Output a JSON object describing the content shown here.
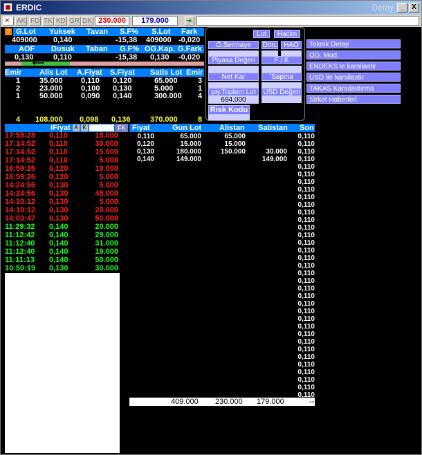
{
  "window": {
    "title": "ERDIC",
    "title_right": "Detay",
    "min": "_",
    "close": "X"
  },
  "toolbar": {
    "buttons": [
      "AK",
      "FD",
      "TK",
      "KD",
      "GR",
      "DK"
    ],
    "field1": "230.000",
    "field2": "179.000"
  },
  "top_table": {
    "row1_headers": [
      "G.Lot",
      "Yuksek",
      "Tavan",
      "S.F%",
      "S.Lot",
      "Fark"
    ],
    "row1_values": [
      "409000",
      "0,140",
      "",
      "-15,38",
      "409000",
      "-0,020"
    ],
    "row2_headers": [
      "AOF",
      "Dusuk",
      "Taban",
      "G.F%",
      "OG.Kap.",
      "G.Fark"
    ],
    "row2_values": [
      "0,130",
      "0,110",
      "",
      "-15,38",
      "0,130",
      "-0,020"
    ]
  },
  "depth": {
    "headers": [
      "Emir",
      "Alis Lot",
      "A.Fiyat",
      "S.Fiyat",
      "Satis Lot",
      "Emir"
    ],
    "rows": [
      [
        "1",
        "35.000",
        "0,110",
        "0,120",
        "65.000",
        "3"
      ],
      [
        "2",
        "23.000",
        "0,100",
        "0,130",
        "5.000",
        "1"
      ],
      [
        "1",
        "50.000",
        "0,090",
        "0,140",
        "300.000",
        "4"
      ]
    ],
    "totals": [
      "4",
      "108.000",
      "0,098",
      "0,136",
      "370.000",
      "8"
    ]
  },
  "panel": {
    "lot": "Lot",
    "hacim": "Hacim",
    "osermaye": "Ö.Sermaye",
    "don": "Dön.",
    "hao": "HAO",
    "piyasa": "Piyasa Değeri",
    "fk": "F / K",
    "netkar": "Net Kar",
    "sapma": "'Sapma",
    "piytoplam": "piy.Toplam Lot",
    "usd": "USD Değeri",
    "piyval": "694.000",
    "risk": "Risk Kodu"
  },
  "right_menu": [
    "Teknik Detay",
    "OD. Mod.",
    "ENDEKS le karsilastir",
    "USD ile karsilastir",
    "TAKAS Karsılastırma",
    "Sirket Haberleri"
  ],
  "trades": {
    "header": "IFiyat",
    "btn_a": "A",
    "btn_k": "K",
    "btn_fk": "FK",
    "rows": [
      [
        "17:58:28",
        "0,110",
        "15.000",
        "r"
      ],
      [
        "17:14:52",
        "0,110",
        "30.000",
        "r"
      ],
      [
        "17:14:52",
        "0,110",
        "15.000",
        "r"
      ],
      [
        "17:14:52",
        "0,110",
        "5.000",
        "r"
      ],
      [
        "16:59:26",
        "0,120",
        "10.000",
        "r"
      ],
      [
        "16:59:26",
        "0,120",
        "5.000",
        "r"
      ],
      [
        "14:24:56",
        "0,130",
        "5.000",
        "r"
      ],
      [
        "14:24:56",
        "0,130",
        "45.000",
        "r"
      ],
      [
        "14:10:12",
        "0,130",
        "5.000",
        "r"
      ],
      [
        "14:10:12",
        "0,130",
        "20.000",
        "r"
      ],
      [
        "14:03:47",
        "0,130",
        "50.000",
        "r"
      ],
      [
        "11:29:32",
        "0,140",
        "20.000",
        "g"
      ],
      [
        "11:12:42",
        "0,140",
        "29.000",
        "g"
      ],
      [
        "11:12:40",
        "0,140",
        "31.000",
        "g"
      ],
      [
        "11:12:40",
        "0,140",
        "19.000",
        "g"
      ],
      [
        "11:11:13",
        "0,140",
        "50.000",
        "g"
      ],
      [
        "10:50:19",
        "0,130",
        "30.000",
        "g"
      ]
    ]
  },
  "summary": {
    "headers": [
      "Fiyat",
      "Gun Lot",
      "Alistan",
      "Satistan",
      "Son"
    ],
    "rows": [
      [
        "0,110",
        "65.000",
        "65.000",
        ""
      ],
      [
        "0,120",
        "15.000",
        "15.000",
        ""
      ],
      [
        "0,130",
        "180.000",
        "150.000",
        "30.000"
      ],
      [
        "0,140",
        "149.000",
        "",
        "149.000"
      ]
    ],
    "son": "0,110",
    "totals": [
      "409.000",
      "230.000",
      "179.000",
      "--"
    ]
  }
}
